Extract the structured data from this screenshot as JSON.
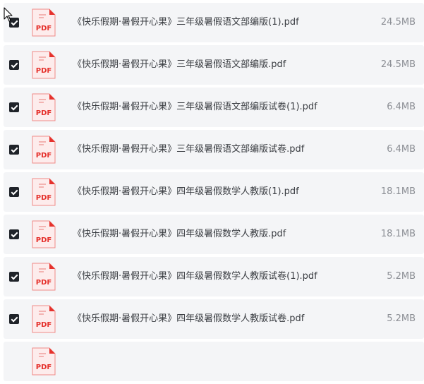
{
  "icons": {
    "file": "pdf-file-icon",
    "checkbox": "checkbox-checked",
    "cursor": "arrow-cursor-icon"
  },
  "colors": {
    "pdf_red": "#e5322d",
    "checkbox": "#1f2329",
    "row_bg": "#f4f5f7"
  },
  "files": [
    {
      "icon_label": "PDF",
      "name": "《快乐假期·暑假开心果》三年级暑假语文部编版(1).pdf",
      "size": "24.5MB",
      "checked": true
    },
    {
      "icon_label": "PDF",
      "name": "《快乐假期·暑假开心果》三年级暑假语文部编版.pdf",
      "size": "24.5MB",
      "checked": true
    },
    {
      "icon_label": "PDF",
      "name": "《快乐假期·暑假开心果》三年级暑假语文部编版试卷(1).pdf",
      "size": "6.4MB",
      "checked": true
    },
    {
      "icon_label": "PDF",
      "name": "《快乐假期·暑假开心果》三年级暑假语文部编版试卷.pdf",
      "size": "6.4MB",
      "checked": true
    },
    {
      "icon_label": "PDF",
      "name": "《快乐假期·暑假开心果》四年级暑假数学人教版(1).pdf",
      "size": "18.1MB",
      "checked": true
    },
    {
      "icon_label": "PDF",
      "name": "《快乐假期·暑假开心果》四年级暑假数学人教版.pdf",
      "size": "18.1MB",
      "checked": true
    },
    {
      "icon_label": "PDF",
      "name": "《快乐假期·暑假开心果》四年级暑假数学人教版试卷(1).pdf",
      "size": "5.2MB",
      "checked": true
    },
    {
      "icon_label": "PDF",
      "name": "《快乐假期·暑假开心果》四年级暑假数学人教版试卷.pdf",
      "size": "5.2MB",
      "checked": true
    },
    {
      "icon_label": "PDF",
      "name": "",
      "size": "",
      "checked": false
    }
  ]
}
